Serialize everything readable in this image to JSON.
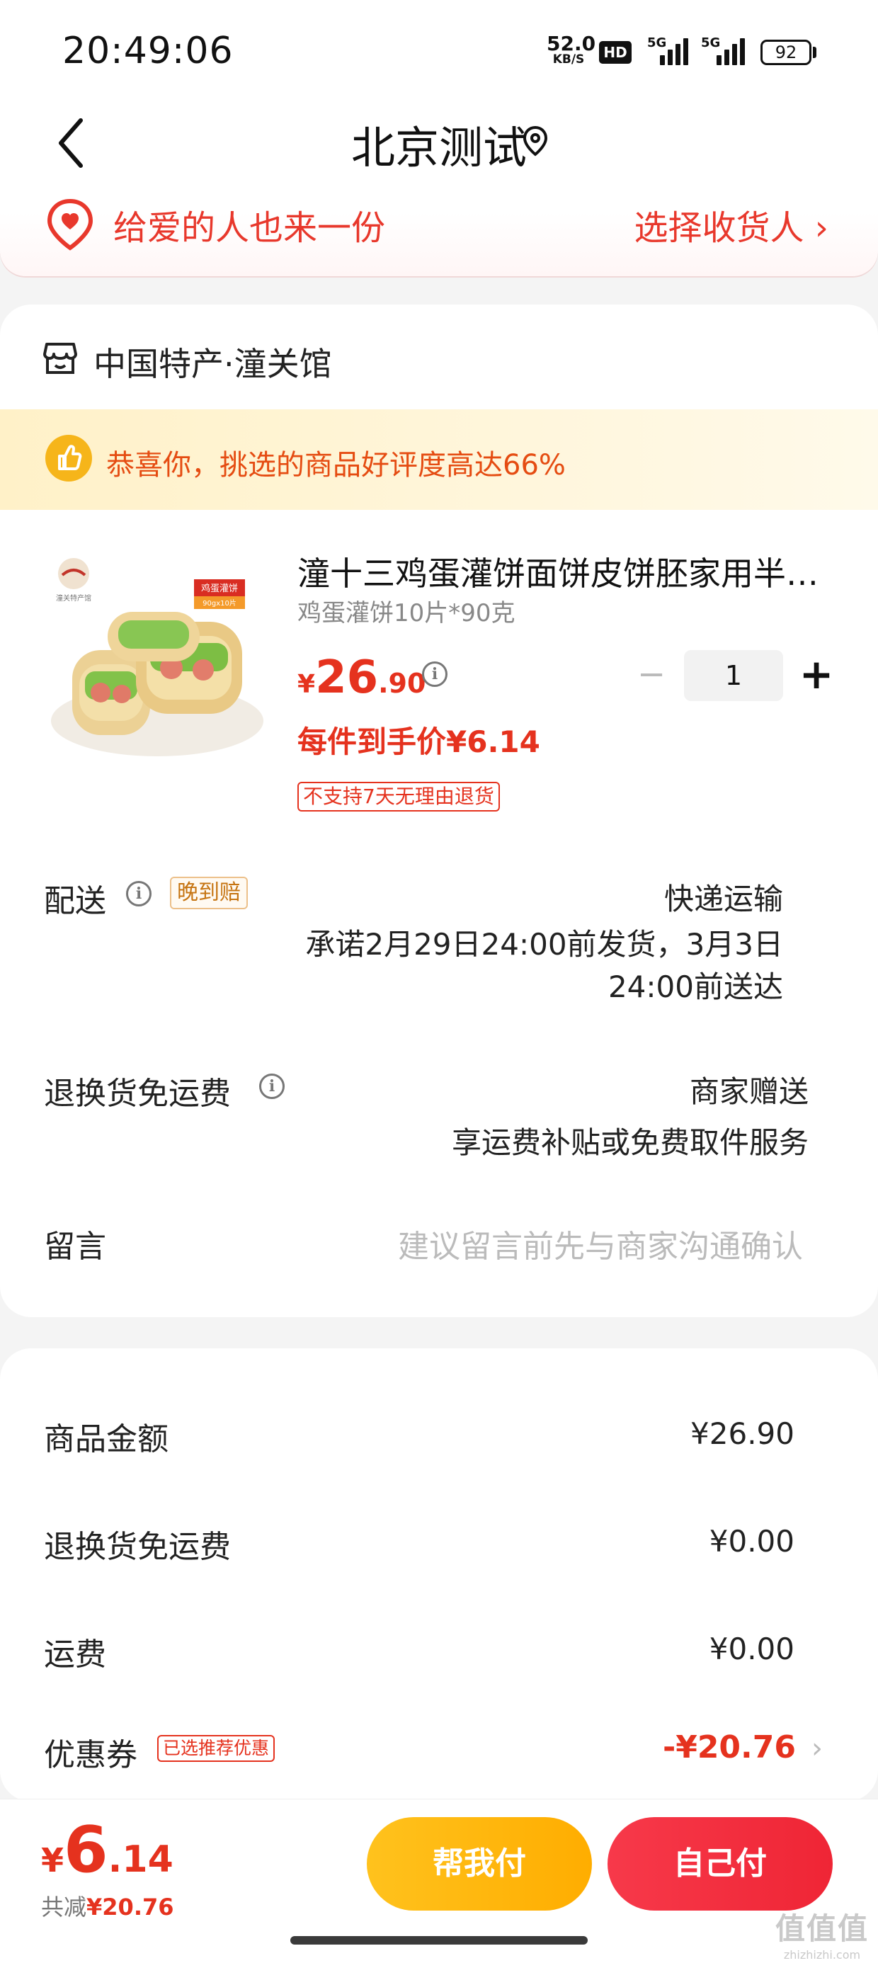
{
  "status_bar": {
    "time": "20:49:06",
    "net_speed": "52.0",
    "net_speed_unit": "KB/S",
    "hd": "HD",
    "sim1": "5G",
    "sim2": "5G",
    "battery": "92"
  },
  "header": {
    "title": "北京测试"
  },
  "gift": {
    "text": "给爱的人也来一份",
    "link": "选择收货人 ›"
  },
  "shop": {
    "name": "中国特产·潼关馆",
    "praise": "恭喜你，挑选的商品好评度高达66%"
  },
  "product": {
    "title": "潼十三鸡蛋灌饼面饼皮饼胚家用半…",
    "spec": "鸡蛋灌饼10片*90克",
    "price_currency": "¥",
    "price_int": "26",
    "price_dec": ".90",
    "quantity": "1",
    "minus": "−",
    "plus": "+",
    "unit_price": "每件到手价¥6.14",
    "no_return": "不支持7天无理由退货",
    "image_badge": "鸡蛋灌饼",
    "image_badge_sub": "90gx10片",
    "image_logo_text": "潼关特产馆"
  },
  "delivery": {
    "label": "配送",
    "badge": "晚到赔",
    "method": "快递运输",
    "line1": "承诺2月29日24:00前发货，3月3日",
    "line2": "24:00前送达"
  },
  "return_shipping": {
    "label": "退换货免运费",
    "value": "商家赠送",
    "sub": "享运费补贴或免费取件服务"
  },
  "message": {
    "label": "留言",
    "placeholder": "建议留言前先与商家沟通确认"
  },
  "summary": {
    "goods_label": "商品金额",
    "goods_value": "¥26.90",
    "return_label": "退换货免运费",
    "return_value": "¥0.00",
    "freight_label": "运费",
    "freight_value": "¥0.00",
    "coupon_label": "优惠券",
    "coupon_badge": "已选推荐优惠",
    "coupon_value": "-¥20.76",
    "chevron": "›"
  },
  "bottom": {
    "total_currency": "¥",
    "total_int": "6",
    "total_dec": ".14",
    "saved_label": "共减",
    "saved_value": "¥20.76",
    "help_pay": "帮我付",
    "self_pay": "自己付"
  },
  "watermark": {
    "big": "值值值",
    "small": "zhizhizhi.com"
  },
  "colors": {
    "accent_red": "#e5321e",
    "yellow_button": "#ffb400",
    "red_button": "#ef2535",
    "praise_bg": "#fff1c8"
  }
}
